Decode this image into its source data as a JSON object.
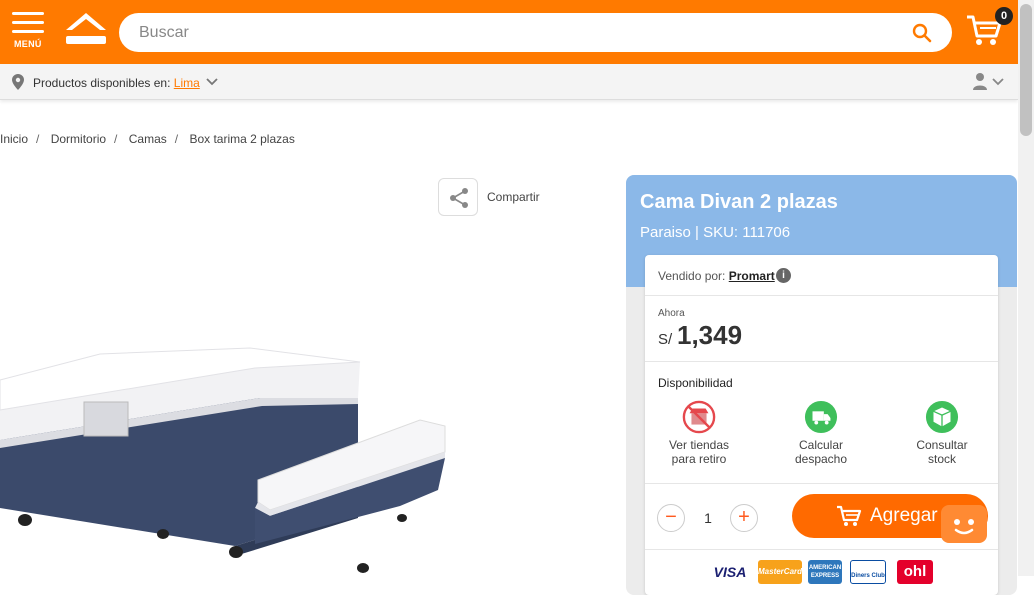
{
  "header": {
    "menu_label": "MENÚ",
    "search_placeholder": "Buscar",
    "cart_count": "0"
  },
  "location": {
    "label": "Productos disponibles en:",
    "city": "Lima"
  },
  "breadcrumb": [
    "Inicio",
    "Dormitorio",
    "Camas",
    "Box tarima 2 plazas"
  ],
  "share_label": "Compartir",
  "product": {
    "title": "Cama Divan 2 plazas",
    "brand_sku": "Paraiso  |  SKU: 111706",
    "seller_label": "Vendido por:",
    "seller_name": "Promart",
    "price_label": "Ahora",
    "currency": "S/",
    "price": "1,349",
    "availability_label": "Disponibilidad",
    "options": [
      {
        "line1": "Ver tiendas",
        "line2": "para retiro",
        "icon": "store-unavailable-icon"
      },
      {
        "line1": "Calcular",
        "line2": "despacho",
        "icon": "truck-icon"
      },
      {
        "line1": "Consultar",
        "line2": "stock",
        "icon": "box-icon"
      }
    ],
    "quantity": "1",
    "add_label": "Agregar"
  },
  "payments": [
    "VISA",
    "MasterCard",
    "AMERICAN EXPRESS",
    "Diners Club",
    "ohl"
  ],
  "colors": {
    "brand_orange": "#ff7a00",
    "panel_blue": "#8bb8e8",
    "available_green": "#3fbf5b",
    "unavailable_red": "#e5484d"
  }
}
